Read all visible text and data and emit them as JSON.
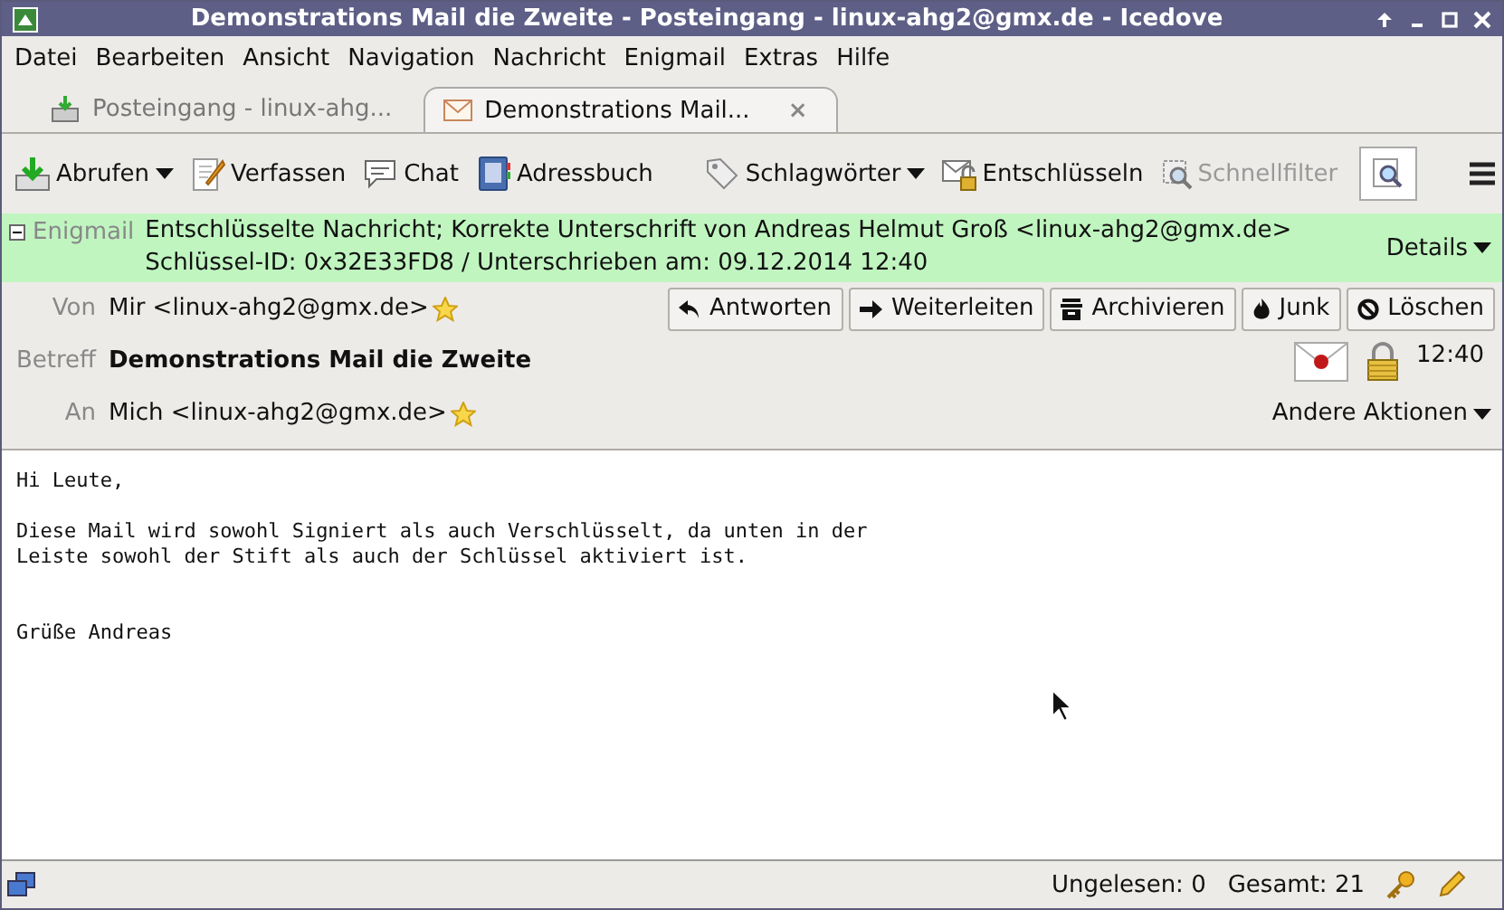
{
  "window": {
    "title": "Demonstrations Mail die Zweite - Posteingang - linux-ahg2@gmx.de - Icedove"
  },
  "menu": [
    "Datei",
    "Bearbeiten",
    "Ansicht",
    "Navigation",
    "Nachricht",
    "Enigmail",
    "Extras",
    "Hilfe"
  ],
  "tabs": [
    {
      "label": "Posteingang - linux-ahg...",
      "selected": false
    },
    {
      "label": "Demonstrations Mail...",
      "selected": true,
      "close": "×"
    }
  ],
  "toolbar": [
    {
      "kind": "button",
      "label": "Abrufen",
      "dropdown": true
    },
    {
      "kind": "button",
      "label": "Verfassen",
      "dropdown": false
    },
    {
      "kind": "button",
      "label": "Chat",
      "dropdown": false
    },
    {
      "kind": "button",
      "label": "Adressbuch",
      "dropdown": false
    },
    {
      "kind": "spacer"
    },
    {
      "kind": "button",
      "label": "Schlagwörter",
      "dropdown": true
    },
    {
      "kind": "button",
      "label": "Entschlüsseln",
      "dropdown": false
    },
    {
      "kind": "filter",
      "label": "Schnellfilter",
      "disabled": true
    }
  ],
  "enigmail": {
    "label": "Enigmail",
    "expanded": true,
    "line1": "Entschlüsselte Nachricht; Korrekte Unterschrift von Andreas Helmut Groß <linux-ahg2@gmx.de>",
    "line2": "Schlüssel-ID: 0x32E33FD8 / Unterschrieben am: 09.12.2014 12:40",
    "details": "Details"
  },
  "header": {
    "from_label": "Von",
    "from": "Mir <linux-ahg2@gmx.de>",
    "subject_label": "Betreff",
    "subject": "Demonstrations Mail die Zweite",
    "to_label": "An",
    "to": "Mich <linux-ahg2@gmx.de>",
    "time": "12:40",
    "more": "Andere Aktionen"
  },
  "actions": [
    "Antworten",
    "Weiterleiten",
    "Archivieren",
    "Junk",
    "Löschen"
  ],
  "body": "Hi Leute,\n\nDiese Mail wird sowohl Signiert als auch Verschlüsselt, da unten in der\nLeiste sowohl der Stift als auch der Schlüssel aktiviert ist.\n\n\nGrüße Andreas",
  "status_bar": {
    "unread": "Ungelesen: 0",
    "total": "Gesamt: 21"
  }
}
